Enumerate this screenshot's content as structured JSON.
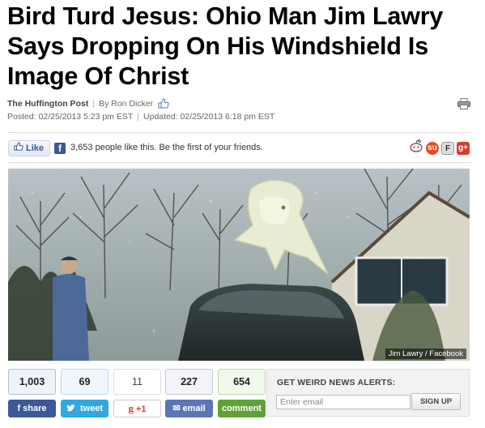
{
  "headline": "Bird Turd Jesus: Ohio Man Jim Lawry Says Dropping On His Windshield Is Image Of Christ",
  "byline": {
    "source": "The Huffington Post",
    "author": "By Ron Dicker",
    "posted": "Posted: 02/25/2013 5:23 pm EST",
    "updated": "Updated: 02/25/2013 6:18 pm EST"
  },
  "facebook": {
    "like_label": "Like",
    "like_text": "3,653 people like this. Be the first of your friends."
  },
  "share_icons": [
    "reddit-icon",
    "stumbleupon-icon",
    "fark-icon",
    "googleplus-icon"
  ],
  "photo": {
    "credit": "Jim Lawry / Facebook"
  },
  "share_counts": [
    {
      "count": "1,003",
      "label": "share",
      "icon": "f"
    },
    {
      "count": "69",
      "label": "tweet",
      "icon": "❦"
    },
    {
      "count": "11",
      "label": "+1",
      "icon": "g"
    },
    {
      "count": "227",
      "label": "email",
      "icon": "✉"
    },
    {
      "count": "654",
      "label": "comment",
      "icon": ""
    }
  ],
  "alerts": {
    "title": "GET WEIRD NEWS ALERTS:",
    "email_placeholder": "Enter email",
    "signup_label": "SIGN UP"
  },
  "colors": {
    "facebook": "#3b5998",
    "twitter": "#2fa9e0",
    "googleplus": "#d23f31",
    "email": "#5b76b8",
    "comment": "#5fa237"
  }
}
